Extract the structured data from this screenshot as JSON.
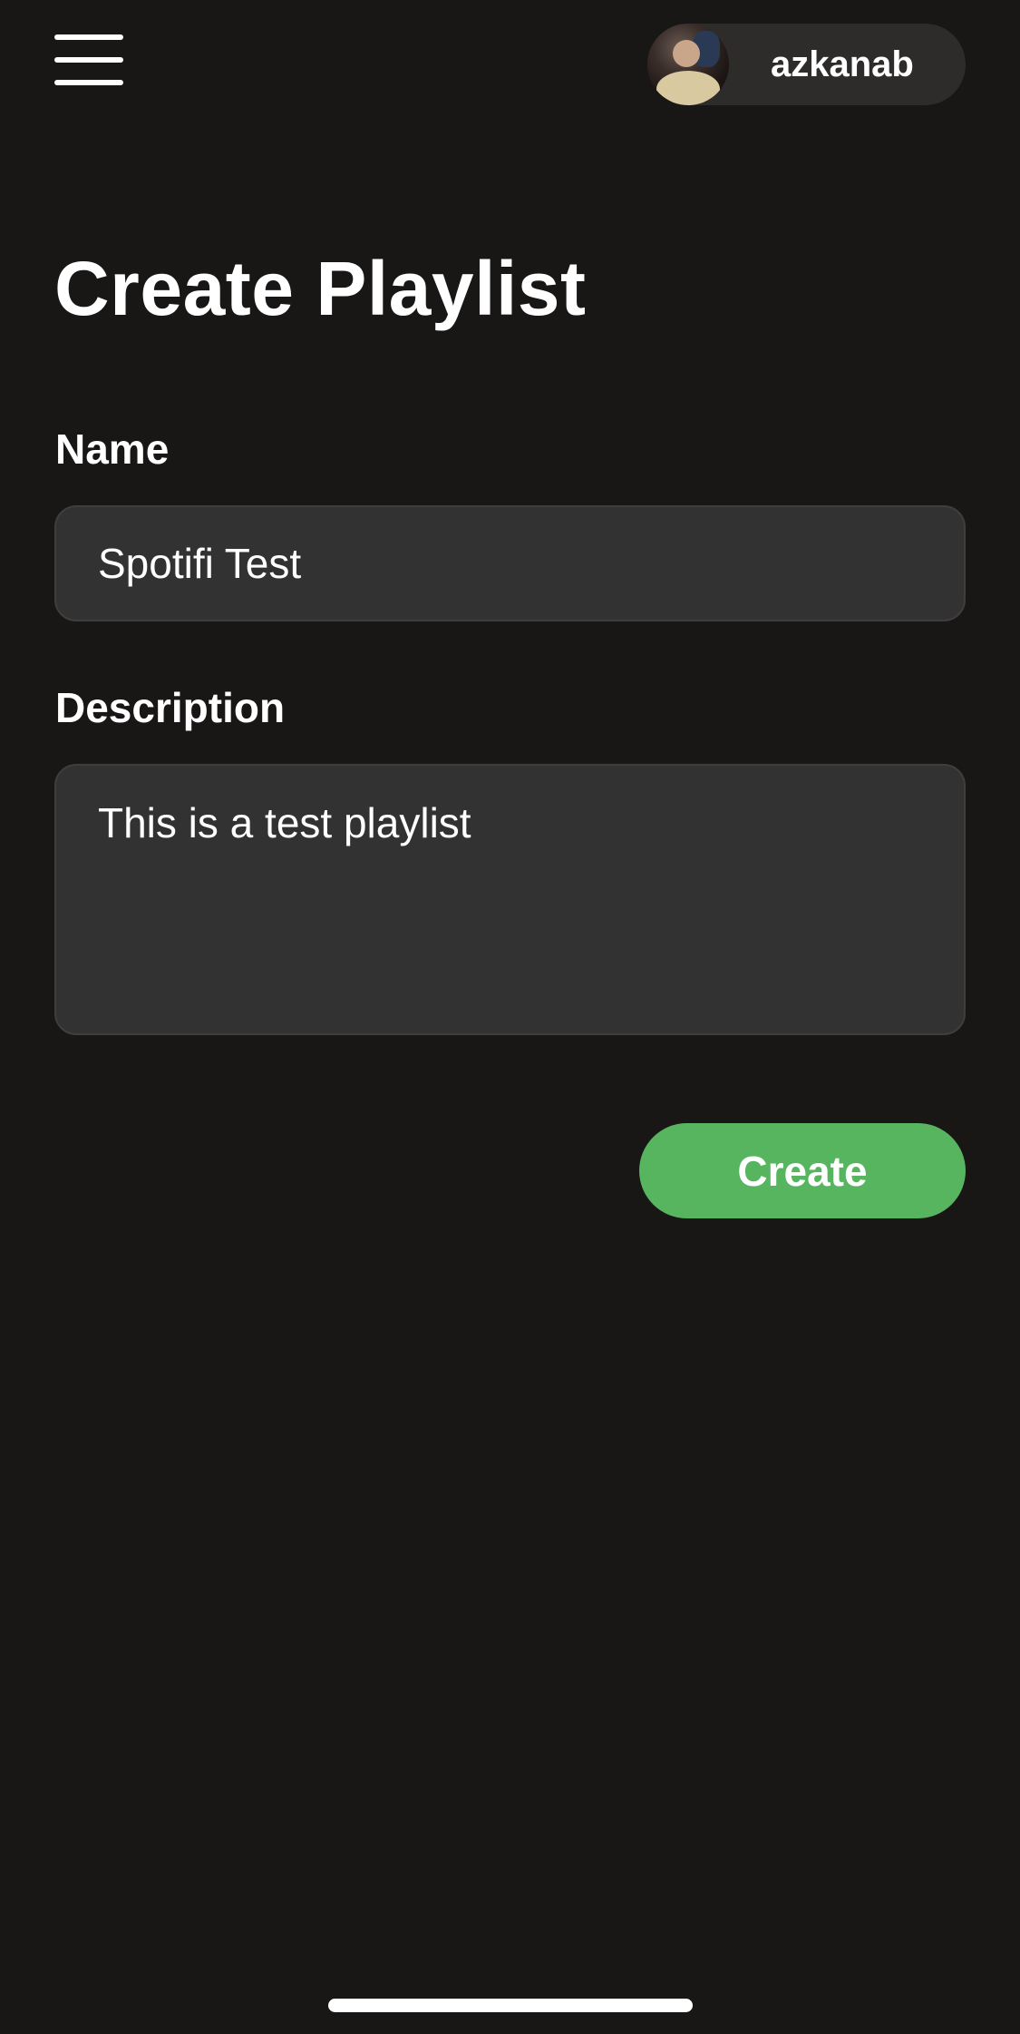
{
  "header": {
    "menu_icon": "hamburger-menu-icon",
    "user": {
      "username": "azkanab",
      "avatar_icon": "user-avatar-photo"
    }
  },
  "main": {
    "title": "Create Playlist",
    "name_field": {
      "label": "Name",
      "value": "Spotifi Test"
    },
    "description_field": {
      "label": "Description",
      "value": "This is a test playlist"
    },
    "create_button_label": "Create"
  },
  "colors": {
    "background": "#191616",
    "field_background": "#333232",
    "accent_green": "#57b560",
    "text": "#ffffff"
  }
}
